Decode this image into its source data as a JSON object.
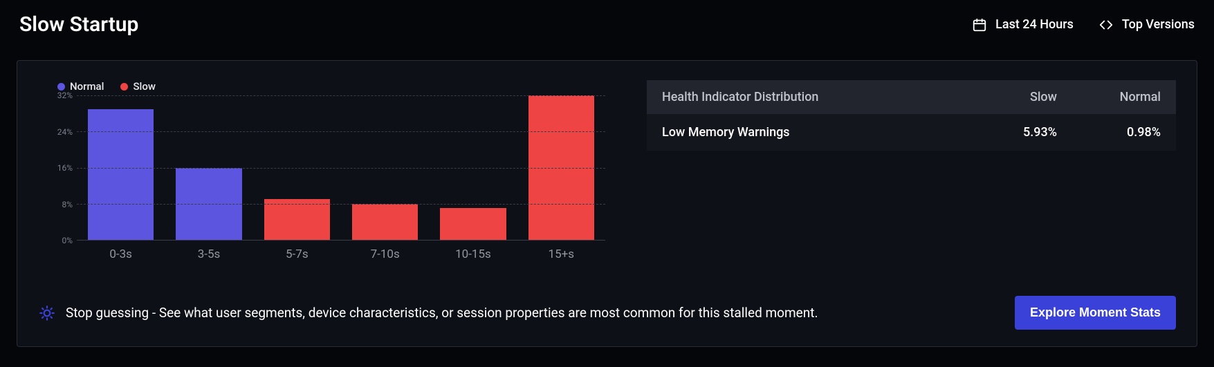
{
  "header": {
    "title": "Slow Startup",
    "time_range_label": "Last 24 Hours",
    "versions_label": "Top Versions"
  },
  "legend": {
    "normal": {
      "label": "Normal",
      "color": "#5b55e0"
    },
    "slow": {
      "label": "Slow",
      "color": "#ef4444"
    }
  },
  "chart_data": {
    "type": "bar",
    "categories": [
      "0-3s",
      "3-5s",
      "5-7s",
      "7-10s",
      "10-15s",
      "15+s"
    ],
    "series": [
      {
        "name": "Normal",
        "color": "#5b55e0",
        "values": [
          29,
          16,
          0,
          0,
          0,
          0
        ]
      },
      {
        "name": "Slow",
        "color": "#ef4444",
        "values": [
          0,
          0,
          9,
          8,
          7,
          32
        ]
      }
    ],
    "ylabel": "",
    "xlabel": "",
    "ylim": [
      0,
      32
    ],
    "y_ticks": [
      0,
      8,
      16,
      24,
      32
    ],
    "y_tick_suffix": "%"
  },
  "dist_table": {
    "columns": [
      "Health Indicator Distribution",
      "Slow",
      "Normal"
    ],
    "rows": [
      {
        "name": "Low Memory Warnings",
        "slow": "5.93%",
        "normal": "0.98%"
      }
    ]
  },
  "hint": {
    "text": "Stop guessing - See what user segments, device characteristics, or session properties are most common for this stalled moment."
  },
  "explore_button_label": "Explore Moment Stats"
}
